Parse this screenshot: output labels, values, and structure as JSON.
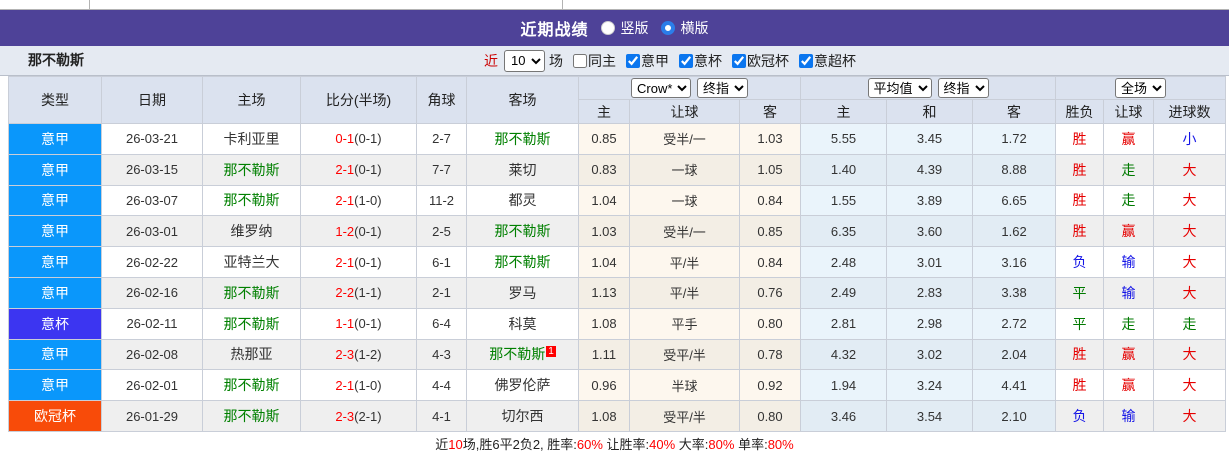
{
  "titlebar": {
    "title": "近期战绩",
    "vertical_label": "竖版",
    "horizontal_label": "横版"
  },
  "filterbar": {
    "team": "那不勒斯",
    "near_label": "近",
    "near_value": "10",
    "games_label": "场",
    "same_home_label": "同主",
    "league_serie_a": "意甲",
    "league_coppa": "意杯",
    "league_ucl": "欧冠杯",
    "league_super": "意超杯"
  },
  "table": {
    "selects": {
      "bookmaker": "Crow*",
      "asia_time": "终指",
      "euro_source": "平均值",
      "euro_time": "终指",
      "scope": "全场"
    },
    "headers": {
      "type": "类型",
      "date": "日期",
      "home": "主场",
      "score": "比分(半场)",
      "corner": "角球",
      "away": "客场",
      "asia_home": "主",
      "asia_line": "让球",
      "asia_away": "客",
      "euro_home": "主",
      "euro_draw": "和",
      "euro_away": "客",
      "result": "胜负",
      "handicap": "让球",
      "goals": "进球数"
    },
    "rows": [
      {
        "type": "意甲",
        "type_color": "#0a97fb",
        "date": "26-03-21",
        "home": "卡利亚里",
        "home_team": false,
        "score": "0-1",
        "half": "(0-1)",
        "corner": "2-7",
        "away": "那不勒斯",
        "away_team": true,
        "card": "",
        "odds": [
          "0.85",
          "受半/一",
          "1.03"
        ],
        "euro": [
          "5.55",
          "3.45",
          "1.72"
        ],
        "result": {
          "text": "胜",
          "c": "red"
        },
        "handicap": {
          "text": "赢",
          "c": "red"
        },
        "goals": {
          "text": "小",
          "c": "blue"
        }
      },
      {
        "type": "意甲",
        "type_color": "#0a97fb",
        "date": "26-03-15",
        "home": "那不勒斯",
        "home_team": true,
        "score": "2-1",
        "half": "(0-1)",
        "corner": "7-7",
        "away": "莱切",
        "away_team": false,
        "card": "",
        "odds": [
          "0.83",
          "一球",
          "1.05"
        ],
        "euro": [
          "1.40",
          "4.39",
          "8.88"
        ],
        "result": {
          "text": "胜",
          "c": "red"
        },
        "handicap": {
          "text": "走",
          "c": "green"
        },
        "goals": {
          "text": "大",
          "c": "red"
        }
      },
      {
        "type": "意甲",
        "type_color": "#0a97fb",
        "date": "26-03-07",
        "home": "那不勒斯",
        "home_team": true,
        "score": "2-1",
        "half": "(1-0)",
        "corner": "11-2",
        "away": "都灵",
        "away_team": false,
        "card": "",
        "odds": [
          "1.04",
          "一球",
          "0.84"
        ],
        "euro": [
          "1.55",
          "3.89",
          "6.65"
        ],
        "result": {
          "text": "胜",
          "c": "red"
        },
        "handicap": {
          "text": "走",
          "c": "green"
        },
        "goals": {
          "text": "大",
          "c": "red"
        }
      },
      {
        "type": "意甲",
        "type_color": "#0a97fb",
        "date": "26-03-01",
        "home": "维罗纳",
        "home_team": false,
        "score": "1-2",
        "half": "(0-1)",
        "corner": "2-5",
        "away": "那不勒斯",
        "away_team": true,
        "card": "",
        "odds": [
          "1.03",
          "受半/一",
          "0.85"
        ],
        "euro": [
          "6.35",
          "3.60",
          "1.62"
        ],
        "result": {
          "text": "胜",
          "c": "red"
        },
        "handicap": {
          "text": "赢",
          "c": "red"
        },
        "goals": {
          "text": "大",
          "c": "red"
        }
      },
      {
        "type": "意甲",
        "type_color": "#0a97fb",
        "date": "26-02-22",
        "home": "亚特兰大",
        "home_team": false,
        "score": "2-1",
        "half": "(0-1)",
        "corner": "6-1",
        "away": "那不勒斯",
        "away_team": true,
        "card": "",
        "odds": [
          "1.04",
          "平/半",
          "0.84"
        ],
        "euro": [
          "2.48",
          "3.01",
          "3.16"
        ],
        "result": {
          "text": "负",
          "c": "blue"
        },
        "handicap": {
          "text": "输",
          "c": "blue"
        },
        "goals": {
          "text": "大",
          "c": "red"
        }
      },
      {
        "type": "意甲",
        "type_color": "#0a97fb",
        "date": "26-02-16",
        "home": "那不勒斯",
        "home_team": true,
        "score": "2-2",
        "half": "(1-1)",
        "corner": "2-1",
        "away": "罗马",
        "away_team": false,
        "card": "",
        "odds": [
          "1.13",
          "平/半",
          "0.76"
        ],
        "euro": [
          "2.49",
          "2.83",
          "3.38"
        ],
        "result": {
          "text": "平",
          "c": "green"
        },
        "handicap": {
          "text": "输",
          "c": "blue"
        },
        "goals": {
          "text": "大",
          "c": "red"
        }
      },
      {
        "type": "意杯",
        "type_color": "#3c35f1",
        "date": "26-02-11",
        "home": "那不勒斯",
        "home_team": true,
        "score": "1-1",
        "half": "(0-1)",
        "corner": "6-4",
        "away": "科莫",
        "away_team": false,
        "card": "",
        "odds": [
          "1.08",
          "平手",
          "0.80"
        ],
        "euro": [
          "2.81",
          "2.98",
          "2.72"
        ],
        "result": {
          "text": "平",
          "c": "green"
        },
        "handicap": {
          "text": "走",
          "c": "green"
        },
        "goals": {
          "text": "走",
          "c": "green"
        }
      },
      {
        "type": "意甲",
        "type_color": "#0a97fb",
        "date": "26-02-08",
        "home": "热那亚",
        "home_team": false,
        "score": "2-3",
        "half": "(1-2)",
        "corner": "4-3",
        "away": "那不勒斯",
        "away_team": true,
        "card": "1",
        "odds": [
          "1.11",
          "受平/半",
          "0.78"
        ],
        "euro": [
          "4.32",
          "3.02",
          "2.04"
        ],
        "result": {
          "text": "胜",
          "c": "red"
        },
        "handicap": {
          "text": "赢",
          "c": "red"
        },
        "goals": {
          "text": "大",
          "c": "red"
        }
      },
      {
        "type": "意甲",
        "type_color": "#0a97fb",
        "date": "26-02-01",
        "home": "那不勒斯",
        "home_team": true,
        "score": "2-1",
        "half": "(1-0)",
        "corner": "4-4",
        "away": "佛罗伦萨",
        "away_team": false,
        "card": "",
        "odds": [
          "0.96",
          "半球",
          "0.92"
        ],
        "euro": [
          "1.94",
          "3.24",
          "4.41"
        ],
        "result": {
          "text": "胜",
          "c": "red"
        },
        "handicap": {
          "text": "赢",
          "c": "red"
        },
        "goals": {
          "text": "大",
          "c": "red"
        }
      },
      {
        "type": "欧冠杯",
        "type_color": "#f84b09",
        "date": "26-01-29",
        "home": "那不勒斯",
        "home_team": true,
        "score": "2-3",
        "half": "(2-1)",
        "corner": "4-1",
        "away": "切尔西",
        "away_team": false,
        "card": "",
        "odds": [
          "1.08",
          "受平/半",
          "0.80"
        ],
        "euro": [
          "3.46",
          "3.54",
          "2.10"
        ],
        "result": {
          "text": "负",
          "c": "blue"
        },
        "handicap": {
          "text": "输",
          "c": "blue"
        },
        "goals": {
          "text": "大",
          "c": "red"
        }
      }
    ]
  },
  "summary": {
    "p1": "近",
    "p2": "10",
    "p3": "场,胜6平2负2, 胜率:",
    "p4": "60%",
    "p5": " 让胜率:",
    "p6": "40%",
    "p7": " 大率:",
    "p8": "80%",
    "p9": " 单率:",
    "p10": "80%"
  },
  "colors": {
    "serie_a_badge": "#0a97fb",
    "coppa_badge": "#3c35f1",
    "ucl_badge": "#f84b09",
    "header_purple": "#4e4298",
    "win_red": "#e60000",
    "draw_green": "#007a00",
    "lose_blue": "#1414e6"
  }
}
